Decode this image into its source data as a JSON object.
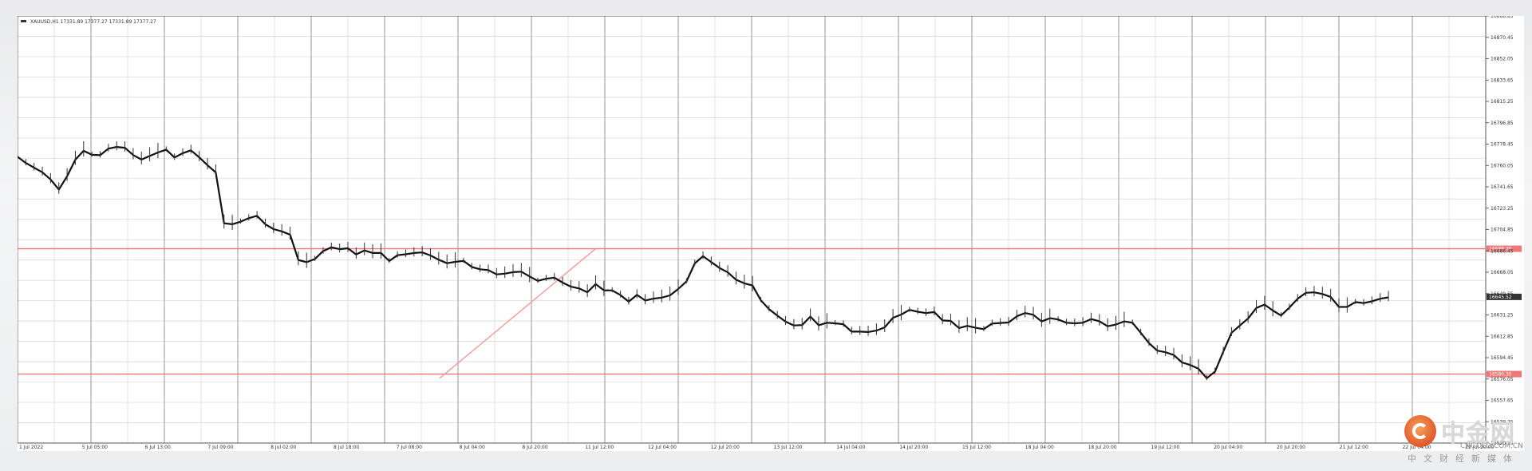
{
  "chart_data": {
    "type": "line",
    "title": "XAUUSD,H1  17331.89 17377.27 17331.89 17377.27",
    "y_ticks": [
      "16888.85",
      "16870.45",
      "16852.05",
      "16833.65",
      "16815.25",
      "16796.85",
      "16778.45",
      "16760.05",
      "16741.65",
      "16723.25",
      "16704.85",
      "16686.45",
      "16668.05",
      "16649.65",
      "16631.25",
      "16612.85",
      "16594.45",
      "16576.05",
      "16557.65",
      "16539.25",
      "16520.85"
    ],
    "x_ticks": [
      "1 Jul 2022",
      "5 Jul 05:00",
      "6 Jul 13:00",
      "7 Jul 09:00",
      "8 Jul 02:00",
      "8 Jul 18:00",
      "7 Jul 08:00",
      "8 Jul 04:00",
      "8 Jul 20:00",
      "11 Jul 12:00",
      "12 Jul 04:00",
      "12 Jul 20:00",
      "13 Jul 12:00",
      "14 Jul 04:00",
      "14 Jul 20:00",
      "15 Jul 12:00",
      "18 Jul 04:00",
      "18 Jul 20:00",
      "19 Jul 12:00",
      "20 Jul 04:00",
      "20 Jul 20:00",
      "21 Jul 12:00",
      "22 Jul 04:00",
      "22 Jul 20:00"
    ],
    "ylim": [
      16520.85,
      16888.85
    ],
    "x": [
      0,
      3,
      6,
      9,
      12,
      15,
      18,
      21,
      24,
      27,
      30,
      33,
      36,
      39,
      42,
      45,
      48,
      51,
      54,
      57,
      60,
      63,
      66,
      69,
      72,
      75,
      78,
      81,
      84,
      87,
      90,
      93,
      96,
      99,
      102,
      105,
      108,
      111,
      114,
      117,
      120,
      123,
      126,
      129,
      132,
      135,
      138,
      141,
      144,
      147,
      150,
      153,
      156,
      159,
      162,
      165,
      168,
      171,
      174,
      177,
      180,
      183,
      186,
      189,
      192,
      195,
      198,
      201,
      204,
      207,
      210,
      213,
      216,
      219,
      222,
      225,
      228,
      231,
      234,
      237,
      240,
      243,
      246,
      249,
      252,
      255,
      258,
      261,
      264,
      267,
      270,
      273,
      276,
      279,
      282,
      285,
      288,
      291,
      294,
      297,
      300,
      303,
      306,
      309,
      312,
      315,
      318,
      321,
      324,
      327,
      330,
      333,
      336,
      339,
      342,
      345,
      348,
      351,
      354,
      357,
      360,
      363,
      366,
      369,
      372,
      375,
      378,
      381,
      384,
      387,
      390,
      393,
      396,
      399,
      402,
      405,
      408,
      411,
      414,
      417,
      420,
      423,
      426,
      429,
      432,
      435,
      438,
      441,
      444,
      447,
      450,
      453,
      456,
      459,
      462,
      465,
      468,
      471,
      474,
      477,
      480,
      483,
      486,
      489,
      492,
      495,
      498
    ],
    "series": [
      {
        "values": [
          16767.5,
          16762.2,
          16758.1,
          16754.2,
          16748.0,
          16739.3,
          16750.8,
          16765.1,
          16772.7,
          16769.2,
          16768.9,
          16774.5,
          16776.0,
          16775.3,
          16769.0,
          16765.1,
          16768.2,
          16771.2,
          16773.7,
          16766.9,
          16770.6,
          16773.1,
          16767.0,
          16760.3,
          16754.0,
          16710.2,
          16709.4,
          16711.6,
          16714.6,
          16716.7,
          16709.4,
          16705.2,
          16703.3,
          16700.4,
          16678.6,
          16676.7,
          16679.4,
          16686.2,
          16689.5,
          16687.9,
          16688.7,
          16683.3,
          16686.8,
          16684.6,
          16684.7,
          16677.7,
          16682.7,
          16683.5,
          16684.6,
          16685.1,
          16682.5,
          16678.8,
          16675.8,
          16677.0,
          16677.8,
          16672.6,
          16670.6,
          16669.9,
          16666.2,
          16666.8,
          16668.1,
          16668.5,
          16664.4,
          16660.6,
          16662.4,
          16663.4,
          16659.1,
          16655.6,
          16654.1,
          16650.8,
          16657.8,
          16652.5,
          16652.4,
          16648.4,
          16642.7,
          16648.5,
          16643.7,
          16645.3,
          16646.2,
          16648.1,
          16653.6,
          16660.2,
          16675.6,
          16681.9,
          16676.8,
          16671.7,
          16667.9,
          16661.6,
          16658.5,
          16656.6,
          16643.9,
          16636.3,
          16630.6,
          16625.5,
          16622.2,
          16622.5,
          16629.9,
          16622.4,
          16624.5,
          16624.0,
          16623.2,
          16616.9,
          16616.9,
          16616.5,
          16617.8,
          16620.6,
          16628.8,
          16631.6,
          16635.6,
          16634.0,
          16632.8,
          16633.7,
          16626.5,
          16626.1,
          16620.0,
          16621.8,
          16620.2,
          16619.0,
          16623.8,
          16624.3,
          16624.7,
          16630.1,
          16632.9,
          16631.4,
          16625.6,
          16628.4,
          16627.3,
          16624.5,
          16624.0,
          16624.5,
          16627.7,
          16625.8,
          16621.5,
          16623.0,
          16625.7,
          16624.5,
          16615.9,
          16607.0,
          16600.5,
          16599.1,
          16596.7,
          16590.3,
          16588.1,
          16584.9,
          16576.7,
          16582.5,
          16599.6,
          16615.9,
          16622.1,
          16628.2,
          16637.2,
          16640.2,
          16635.0,
          16630.8,
          16637.6,
          16645.2,
          16650.3,
          16650.7,
          16649.3,
          16646.8,
          16638.1,
          16638.2,
          16642.3,
          16641.4,
          16643.0,
          16645.2,
          16646.4,
          16645.5,
          16646.8
        ]
      }
    ],
    "levels": [
      {
        "label": "16688.30",
        "value": 16688.3
      },
      {
        "label": "16580.30",
        "value": 16580.3
      }
    ],
    "trendline": {
      "from_x": 460,
      "from_y": 16576.7,
      "to_x": 630,
      "to_y": 16688.3
    },
    "current_label": "16645.52",
    "vertical_grid_count": 40,
    "horizontal_grid_count": 21,
    "grid": true,
    "colors": {
      "line": "#111111",
      "level": "#ee7777",
      "trend": "#f29a9a",
      "grid": "#d6d6d6",
      "grid_major": "#999999"
    }
  },
  "watermark": {
    "name": "中金网",
    "domain": "CNGOLD.COM.CN",
    "slogan": "中文财经新媒体"
  }
}
